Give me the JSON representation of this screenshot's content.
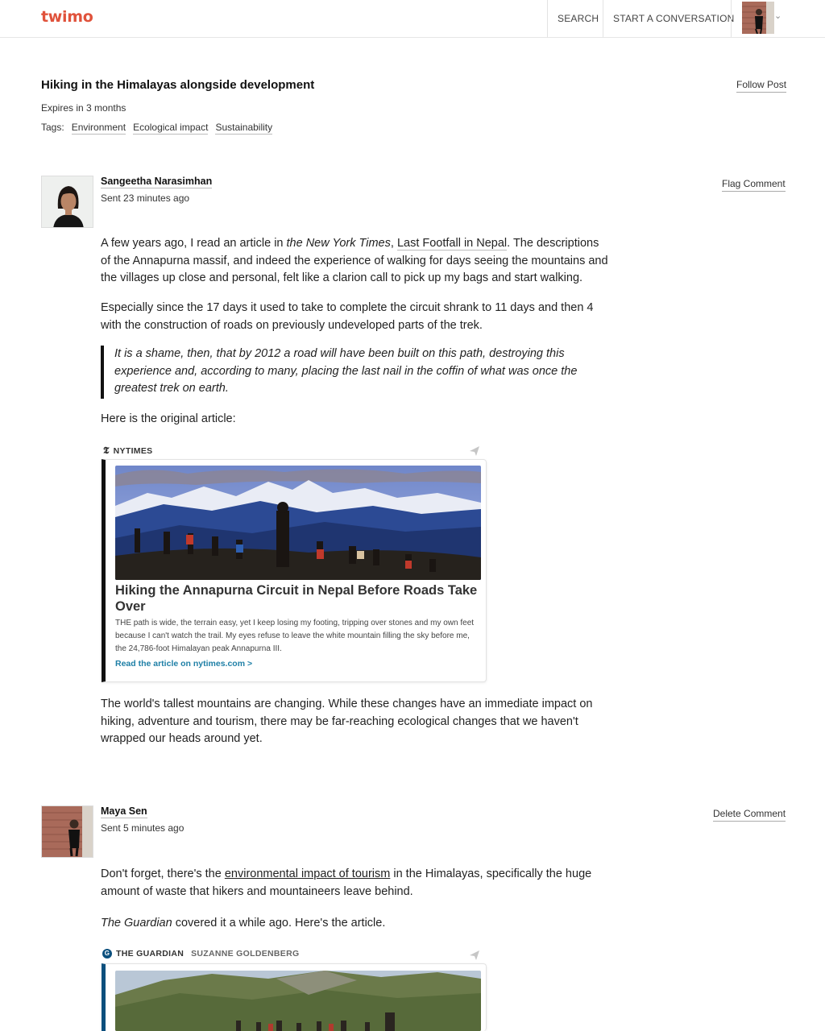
{
  "header": {
    "logo": "twimo",
    "nav": {
      "search": "SEARCH",
      "start": "START A CONVERSATION"
    }
  },
  "post": {
    "title": "Hiking in the Himalayas alongside development",
    "expires": "Expires in 3 months",
    "tags_label": "Tags:",
    "tags": [
      "Environment",
      "Ecological impact",
      "Sustainability"
    ],
    "follow": "Follow Post"
  },
  "comments": [
    {
      "author": "Sangeetha Narasimhan",
      "sent": "Sent 23 minutes ago",
      "action": "Flag Comment",
      "p1": {
        "a": "A few years ago, I read an article in ",
        "italic": "the New York Times",
        "b": ", ",
        "link": "Last Footfall in Nepal",
        "c": ". The descriptions of the Annapurna massif, and indeed the experience of walking for days seeing the mountains and the villages up close and personal, felt like a clarion call to pick up my bags and start walking."
      },
      "p2": "Especially since the 17 days it used to take to complete the circuit shrank to 11 days and then 4 with the construction of roads on previously undeveloped parts of the trek.",
      "quote": "It is a shame, then, that by 2012 a road will have been built on this path, destroying this experience and, according to many, placing the last nail in the coffin of what was once the greatest trek on earth.",
      "p3": "Here is the original article:",
      "embed": {
        "source": "NYTIMES",
        "title": "Hiking the Annapurna Circuit in Nepal Before Roads Take Over",
        "desc": "THE path is wide, the terrain easy, yet I keep losing my footing, tripping over stones and my own feet because I can't watch the trail. My eyes refuse to leave the white mountain filling the sky before me, the 24,786-foot Himalayan peak Annapurna III.",
        "link": "Read the article on nytimes.com >"
      },
      "p4": "The world's tallest mountains are changing. While these changes have an immediate impact on hiking, adventure and tourism, there may be far-reaching ecological changes that we haven't wrapped our heads around yet."
    },
    {
      "author": "Maya Sen",
      "sent": "Sent 5 minutes ago",
      "action": "Delete Comment",
      "p1": {
        "a": "Don't forget, there's the ",
        "link": "environmental impact of tourism",
        "b": " in the Himalayas, specifically the huge amount of waste that hikers and mountaineers leave behind."
      },
      "p2": {
        "italic": "The Guardian",
        "rest": " covered it a while ago. Here's the article."
      },
      "embed": {
        "source": "THE GUARDIAN",
        "author": "SUZANNE GOLDENBERG"
      }
    }
  ],
  "colors": {
    "brand": "#e0523b",
    "link": "#1e7fa6",
    "guardian": "#0b4f7d"
  },
  "icons": [
    "caret-down-icon",
    "send-icon",
    "nyt-logo-icon",
    "guardian-logo-icon"
  ]
}
